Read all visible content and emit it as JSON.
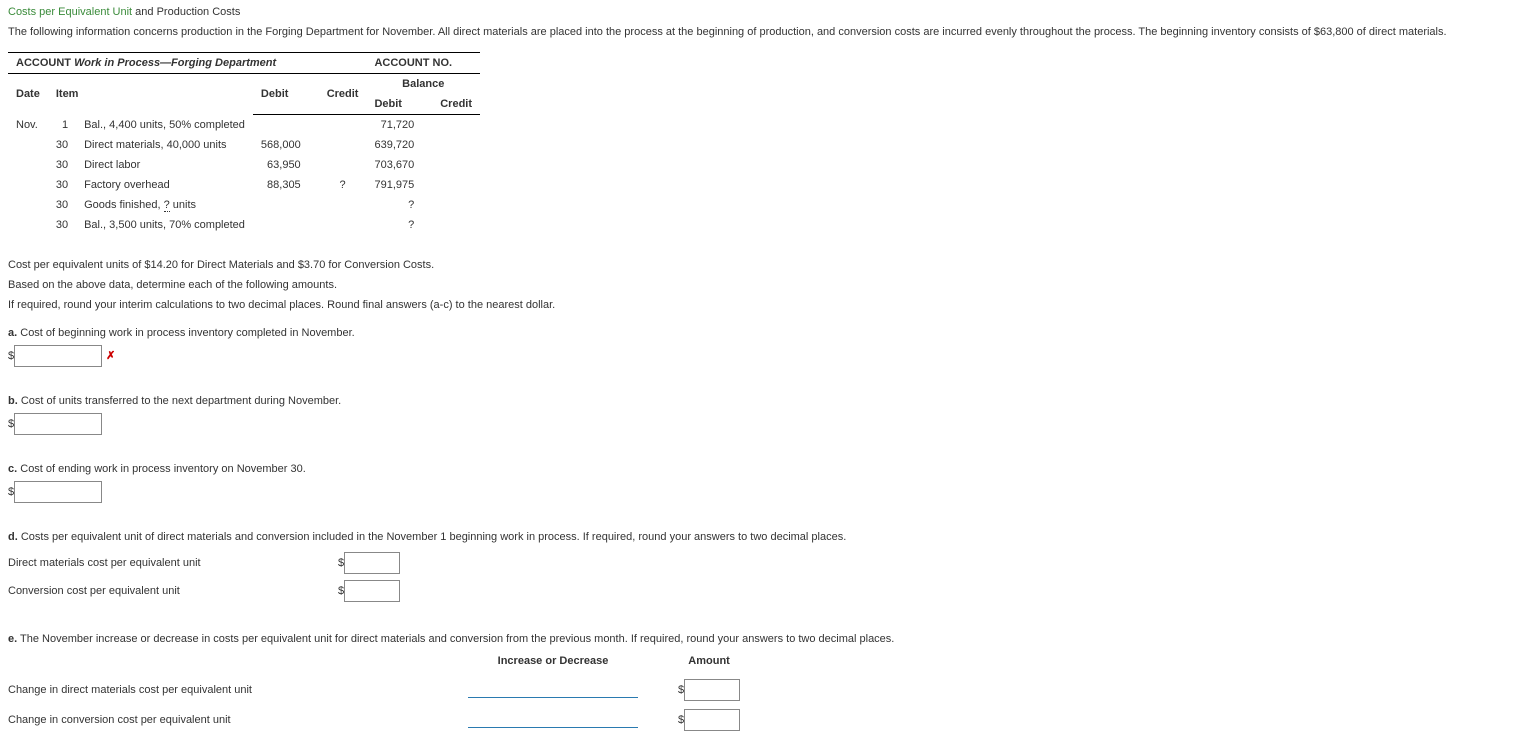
{
  "title": {
    "green": "Costs per Equivalent Unit",
    "rest": " and Production Costs"
  },
  "intro": "The following information concerns production in the Forging Department for November. All direct materials are placed into the process at the beginning of production, and conversion costs are incurred evenly throughout the process. The beginning inventory consists of $63,800 of direct materials.",
  "ledger": {
    "account_label": "ACCOUNT ",
    "account_name": "Work in Process—Forging Department",
    "account_no_label": "ACCOUNT NO.",
    "headers": {
      "date": "Date",
      "item": "Item",
      "debit": "Debit",
      "credit": "Credit",
      "balance": "Balance",
      "bal_debit": "Debit",
      "bal_credit": "Credit"
    },
    "rows": [
      {
        "date": "Nov.",
        "day": "1",
        "item": "Bal., 4,400 units, 50% completed",
        "debit": "",
        "credit": "",
        "bal_debit": "71,720",
        "bal_credit": ""
      },
      {
        "date": "",
        "day": "30",
        "item": "Direct materials, 40,000 units",
        "debit": "568,000",
        "credit": "",
        "bal_debit": "639,720",
        "bal_credit": ""
      },
      {
        "date": "",
        "day": "30",
        "item": "Direct labor",
        "debit": "63,950",
        "credit": "",
        "bal_debit": "703,670",
        "bal_credit": ""
      },
      {
        "date": "",
        "day": "30",
        "item": "Factory overhead",
        "debit": "88,305",
        "credit": "?",
        "bal_debit": "791,975",
        "bal_credit": ""
      },
      {
        "date": "",
        "day": "30",
        "item_pre": "Goods finished, ",
        "item_link": "?",
        "item_post": " units",
        "debit": "",
        "credit": "",
        "bal_debit": "?",
        "bal_credit": ""
      },
      {
        "date": "",
        "day": "30",
        "item": "Bal., 3,500 units, 70% completed",
        "debit": "",
        "credit": "",
        "bal_debit": "?",
        "bal_credit": ""
      }
    ]
  },
  "note1": "Cost per equivalent units of $14.20 for Direct Materials and $3.70 for Conversion Costs.",
  "note2": "Based on the above data, determine each of the following amounts.",
  "note3": "If required, round your interim calculations to two decimal places. Round final answers (a-c) to the nearest dollar.",
  "qa": {
    "label": "a.",
    "text": " Cost of beginning work in process inventory completed in November."
  },
  "qb": {
    "label": "b.",
    "text": " Cost of units transferred to the next department during November."
  },
  "qc": {
    "label": "c.",
    "text": " Cost of ending work in process inventory on November 30."
  },
  "qd": {
    "label": "d.",
    "text": " Costs per equivalent unit of direct materials and conversion included in the November 1 beginning work in process. If required, round your answers to two decimal places."
  },
  "d_rows": {
    "dm": "Direct materials cost per equivalent unit",
    "conv": "Conversion cost per equivalent unit"
  },
  "qe": {
    "label": "e.",
    "text": " The November increase or decrease in costs per equivalent unit for direct materials and conversion from the previous month. If required, round your answers to two decimal places."
  },
  "e_headers": {
    "inc_dec": "Increase or Decrease",
    "amount": "Amount"
  },
  "e_rows": {
    "dm": "Change in direct materials cost per equivalent unit",
    "conv": "Change in conversion cost per equivalent unit"
  },
  "symbols": {
    "dollar": "$",
    "x": "✗"
  }
}
